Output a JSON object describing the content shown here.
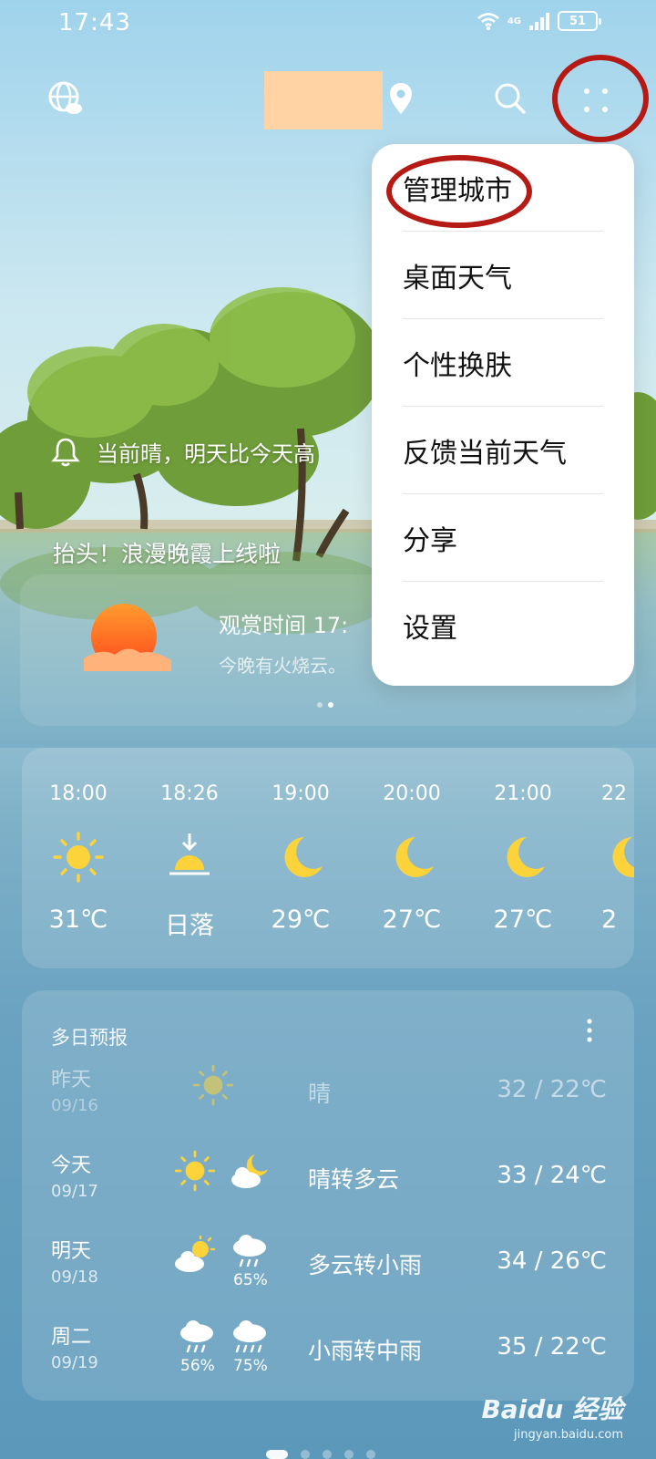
{
  "status_bar": {
    "time": "17:43",
    "network": "4G",
    "battery": "51"
  },
  "top_bar": {
    "globe_icon": "globe-cloud-icon",
    "location_icon": "location-pin-icon",
    "search_icon": "search-icon",
    "more_icon": "four-dot-menu-icon"
  },
  "menu": {
    "items": [
      "管理城市",
      "桌面天气",
      "个性换肤",
      "反馈当前天气",
      "分享",
      "设置"
    ]
  },
  "alert": {
    "text": "当前晴，明天比今天高"
  },
  "sunset": {
    "title": "抬头！浪漫晚霞上线啦",
    "time_label": "观赏时间  17:",
    "note": "今晚有火烧云。"
  },
  "hourly": [
    {
      "time": "18:00",
      "icon": "sun-icon",
      "temp": "31℃"
    },
    {
      "time": "18:26",
      "icon": "sunset-icon",
      "temp": "日落"
    },
    {
      "time": "19:00",
      "icon": "moon-icon",
      "temp": "29℃"
    },
    {
      "time": "20:00",
      "icon": "moon-icon",
      "temp": "27℃"
    },
    {
      "time": "21:00",
      "icon": "moon-icon",
      "temp": "27℃"
    },
    {
      "time": "22",
      "icon": "moon-icon",
      "temp": "2"
    }
  ],
  "daily": {
    "title": "多日预报",
    "rows": [
      {
        "name": "昨天",
        "date": "09/16",
        "cond": "晴",
        "temp": "32 / 22℃",
        "icons": [
          "sun-icon"
        ],
        "pcts": []
      },
      {
        "name": "今天",
        "date": "09/17",
        "cond": "晴转多云",
        "temp": "33 / 24℃",
        "icons": [
          "sun-icon",
          "cloud-moon-icon"
        ],
        "pcts": []
      },
      {
        "name": "明天",
        "date": "09/18",
        "cond": "多云转小雨",
        "temp": "34 / 26℃",
        "icons": [
          "sun-cloud-icon",
          "rain-cloud-icon"
        ],
        "pcts": [
          "",
          "65%"
        ]
      },
      {
        "name": "周二",
        "date": "09/19",
        "cond": "小雨转中雨",
        "temp": "35 / 22℃",
        "icons": [
          "rain-cloud-icon",
          "rain-cloud-icon"
        ],
        "pcts": [
          "56%",
          "75%"
        ]
      }
    ]
  },
  "watermark": {
    "main": "Baidu 经验",
    "sub": "jingyan.baidu.com"
  }
}
